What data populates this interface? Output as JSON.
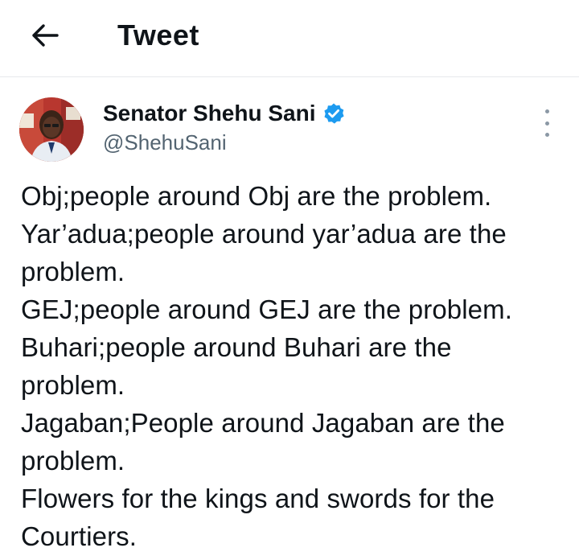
{
  "header": {
    "title": "Tweet",
    "back_icon": "arrow-left-icon"
  },
  "author": {
    "name": "Senator Shehu Sani",
    "handle": "@ShehuSani",
    "verified_icon": "verified-badge-icon",
    "verified_color": "#1d9bf0"
  },
  "more_icon": "more-vertical-icon",
  "tweet": {
    "lines": [
      "Obj;people around Obj are the problem.",
      "Yar’adua;people around yar’adua are the",
      "problem.",
      "GEJ;people around GEJ are the problem.",
      "Buhari;people around Buhari are the",
      "problem.",
      "Jagaban;People around Jagaban are the",
      "problem.",
      "Flowers for the kings and swords for the",
      "Courtiers."
    ]
  }
}
